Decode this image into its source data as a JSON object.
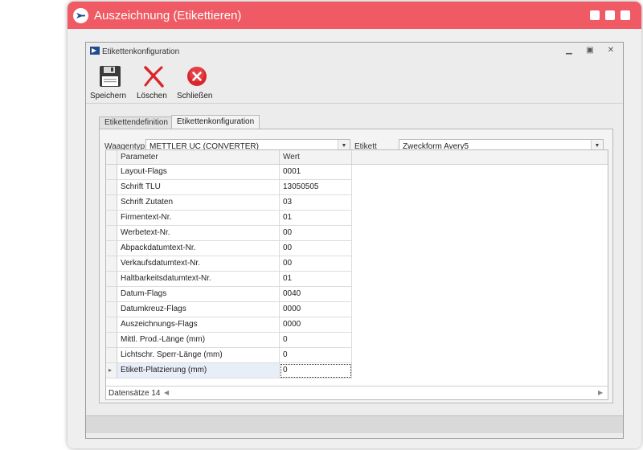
{
  "app": {
    "title": "Auszeichnung (Etikettieren)"
  },
  "window": {
    "title": "Etikettenkonfiguration",
    "controls": {
      "minimize_icon": "minimize-icon",
      "restore_icon": "restore-icon",
      "close_icon": "close-icon"
    }
  },
  "toolbar": {
    "save_label": "Speichern",
    "delete_label": "Löschen",
    "close_label": "Schließen",
    "colors": {
      "delete": "#d9262c",
      "close": "#d9262c"
    }
  },
  "tabs": [
    {
      "label": "Etikettendefinition",
      "active": false
    },
    {
      "label": "Etikettenkonfiguration",
      "active": true
    }
  ],
  "filters": {
    "scale_type_label": "Waagentyp",
    "scale_type_value": "METTLER UC (CONVERTER)",
    "label_label": "Etikett",
    "label_value": "Zweckform Avery5"
  },
  "grid": {
    "columns": [
      "Parameter",
      "Wert"
    ],
    "rows": [
      {
        "parameter": "Layout-Flags",
        "value": "0001"
      },
      {
        "parameter": "Schrift TLU",
        "value": "13050505"
      },
      {
        "parameter": "Schrift Zutaten",
        "value": "03"
      },
      {
        "parameter": "Firmentext-Nr.",
        "value": "01"
      },
      {
        "parameter": "Werbetext-Nr.",
        "value": "00"
      },
      {
        "parameter": "Abpackdatumtext-Nr.",
        "value": "00"
      },
      {
        "parameter": "Verkaufsdatumtext-Nr.",
        "value": "00"
      },
      {
        "parameter": "Haltbarkeitsdatumtext-Nr.",
        "value": "01"
      },
      {
        "parameter": "Datum-Flags",
        "value": "0040"
      },
      {
        "parameter": "Datumkreuz-Flags",
        "value": "0000"
      },
      {
        "parameter": "Auszeichnungs-Flags",
        "value": "0000"
      },
      {
        "parameter": "Mittl. Prod.-Länge (mm)",
        "value": "0"
      },
      {
        "parameter": "Lichtschr. Sperr-Länge (mm)",
        "value": "0"
      },
      {
        "parameter": "Etikett-Platzierung (mm)",
        "value": "0"
      }
    ],
    "selected_row_marker": "▸",
    "footer_text": "Datensätze 14"
  },
  "colors": {
    "title_bar": "#f05a64",
    "accent": "#1f4b8f"
  }
}
